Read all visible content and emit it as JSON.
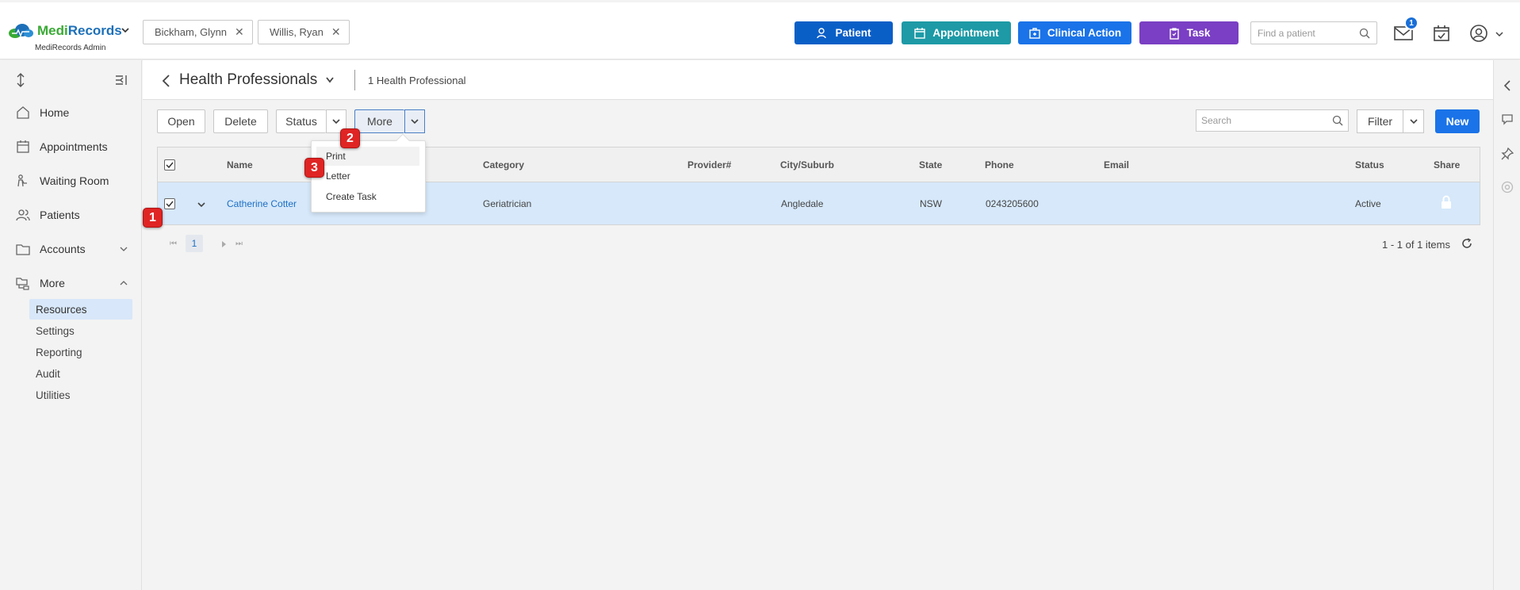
{
  "header": {
    "brand_part1": "Medi",
    "brand_part2": "Records",
    "subtitle": "MediRecords Admin",
    "open_patients": [
      {
        "name": "Bickham, Glynn"
      },
      {
        "name": "Willis, Ryan"
      }
    ],
    "buttons": {
      "patient": "Patient",
      "appointment": "Appointment",
      "clinical_action": "Clinical Action",
      "task": "Task"
    },
    "find_placeholder": "Find a patient",
    "mail_badge": "1",
    "colors": {
      "patient": "#0a5fc7",
      "appointment": "#1d9aa6",
      "clinical_action": "#1a73e8",
      "task": "#7a3fc4"
    }
  },
  "sidebar": {
    "items": [
      {
        "label": "Home",
        "icon": "home-icon"
      },
      {
        "label": "Appointments",
        "icon": "calendar-icon"
      },
      {
        "label": "Waiting Room",
        "icon": "waiting-room-icon"
      },
      {
        "label": "Patients",
        "icon": "patients-icon"
      },
      {
        "label": "Accounts",
        "icon": "folder-icon"
      },
      {
        "label": "More",
        "icon": "folder-tree-icon"
      }
    ],
    "sub_items": [
      {
        "label": "Resources",
        "active": true
      },
      {
        "label": "Settings"
      },
      {
        "label": "Reporting"
      },
      {
        "label": "Audit"
      },
      {
        "label": "Utilities"
      }
    ]
  },
  "page": {
    "title": "Health Professionals",
    "count": "1 Health Professional"
  },
  "toolbar": {
    "open": "Open",
    "delete": "Delete",
    "status": "Status",
    "more": "More",
    "search_placeholder": "Search",
    "filter": "Filter",
    "new": "New"
  },
  "more_menu": {
    "items": [
      "Print",
      "Letter",
      "Create Task"
    ]
  },
  "grid": {
    "columns": [
      "Name",
      "Category",
      "Provider#",
      "City/Suburb",
      "State",
      "Phone",
      "Email",
      "Status",
      "Share"
    ],
    "rows": [
      {
        "name": "Catherine Cotter",
        "category": "Geriatrician",
        "provider": "",
        "city": "Angledale",
        "state": "NSW",
        "phone": "0243205600",
        "email": "",
        "status": "Active"
      }
    ]
  },
  "pager": {
    "page": "1",
    "info": "1 - 1 of 1 items"
  },
  "markers": [
    "1",
    "2",
    "3"
  ]
}
